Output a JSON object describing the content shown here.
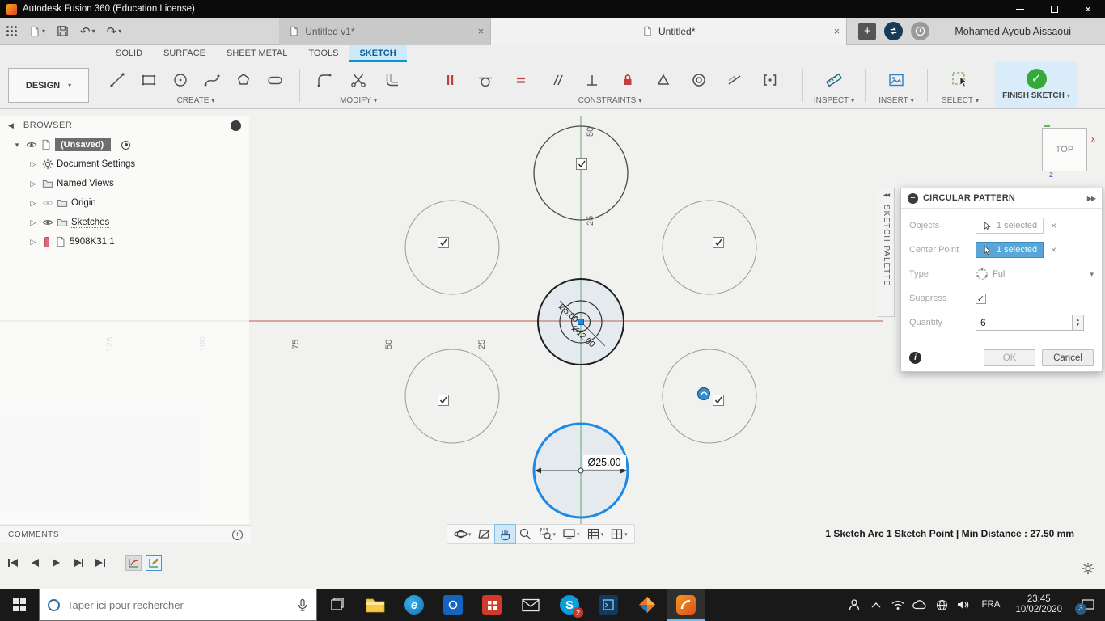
{
  "icons": {
    "close": "×",
    "plus": "+",
    "caret-down": "▾",
    "caret-right": "▷",
    "collapse-left": "◀",
    "collapse-double": "◀◀",
    "expand-double": "▶▶",
    "minus": "−",
    "info": "i",
    "check": "✓",
    "undo": "↶",
    "redo": "↷",
    "spin-up": "▲",
    "spin-down": "▼",
    "edge-logo": "e",
    "skype-logo": "S"
  },
  "titlebar": {
    "title": "Autodesk Fusion 360 (Education License)"
  },
  "tabbar": {
    "documents": [
      {
        "label": "Untitled v1*"
      },
      {
        "label": "Untitled*"
      }
    ],
    "user": "Mohamed Ayoub Aissaoui"
  },
  "ribbon": {
    "workspace": "DESIGN",
    "tabs": [
      "SOLID",
      "SURFACE",
      "SHEET METAL",
      "TOOLS",
      "SKETCH"
    ],
    "groups": {
      "create": "CREATE",
      "modify": "MODIFY",
      "constraints": "CONSTRAINTS",
      "inspect": "INSPECT",
      "insert": "INSERT",
      "select": "SELECT"
    },
    "finish_label": "FINISH SKETCH"
  },
  "browser": {
    "title": "BROWSER",
    "root_label": "(Unsaved)",
    "items": [
      "Document Settings",
      "Named Views",
      "Origin",
      "Sketches",
      "5908K31:1"
    ]
  },
  "viewcube": {
    "face": "TOP",
    "axis_x": "x",
    "axis_z": "z"
  },
  "sketch_palette": {
    "label": "SKETCH PALETTE"
  },
  "dialog": {
    "title": "CIRCULAR PATTERN",
    "objects_label": "Objects",
    "objects_value": "1 selected",
    "center_label": "Center Point",
    "center_value": "1 selected",
    "type_label": "Type",
    "type_value": "Full",
    "suppress_label": "Suppress",
    "quantity_label": "Quantity",
    "quantity_value": "6",
    "ok": "OK",
    "cancel": "Cancel"
  },
  "canvas": {
    "ruler_x": [
      "125",
      "100",
      "75",
      "50",
      "25"
    ],
    "ruler_y": [
      "50",
      "25"
    ],
    "dim_selected": "Ø25.00",
    "dim_inner_small": "Ø5.00",
    "dim_inner_large": "Ø12.00"
  },
  "bottombar": {
    "comments": "COMMENTS",
    "status": "1 Sketch Arc 1 Sketch Point | Min Distance : 27.50 mm"
  },
  "taskbar": {
    "search_placeholder": "Taper ici pour rechercher",
    "language": "FRA",
    "time": "23:45",
    "date": "10/02/2020",
    "notification_count": "3",
    "skype_badge": "2"
  },
  "colors": {
    "accent_blue": "#0696d7",
    "selection_blue": "#1e88e5",
    "finish_green": "#37a93c",
    "axis_red": "#b95c4e",
    "axis_green": "#69a869",
    "highlight_field": "#58a7d8"
  }
}
